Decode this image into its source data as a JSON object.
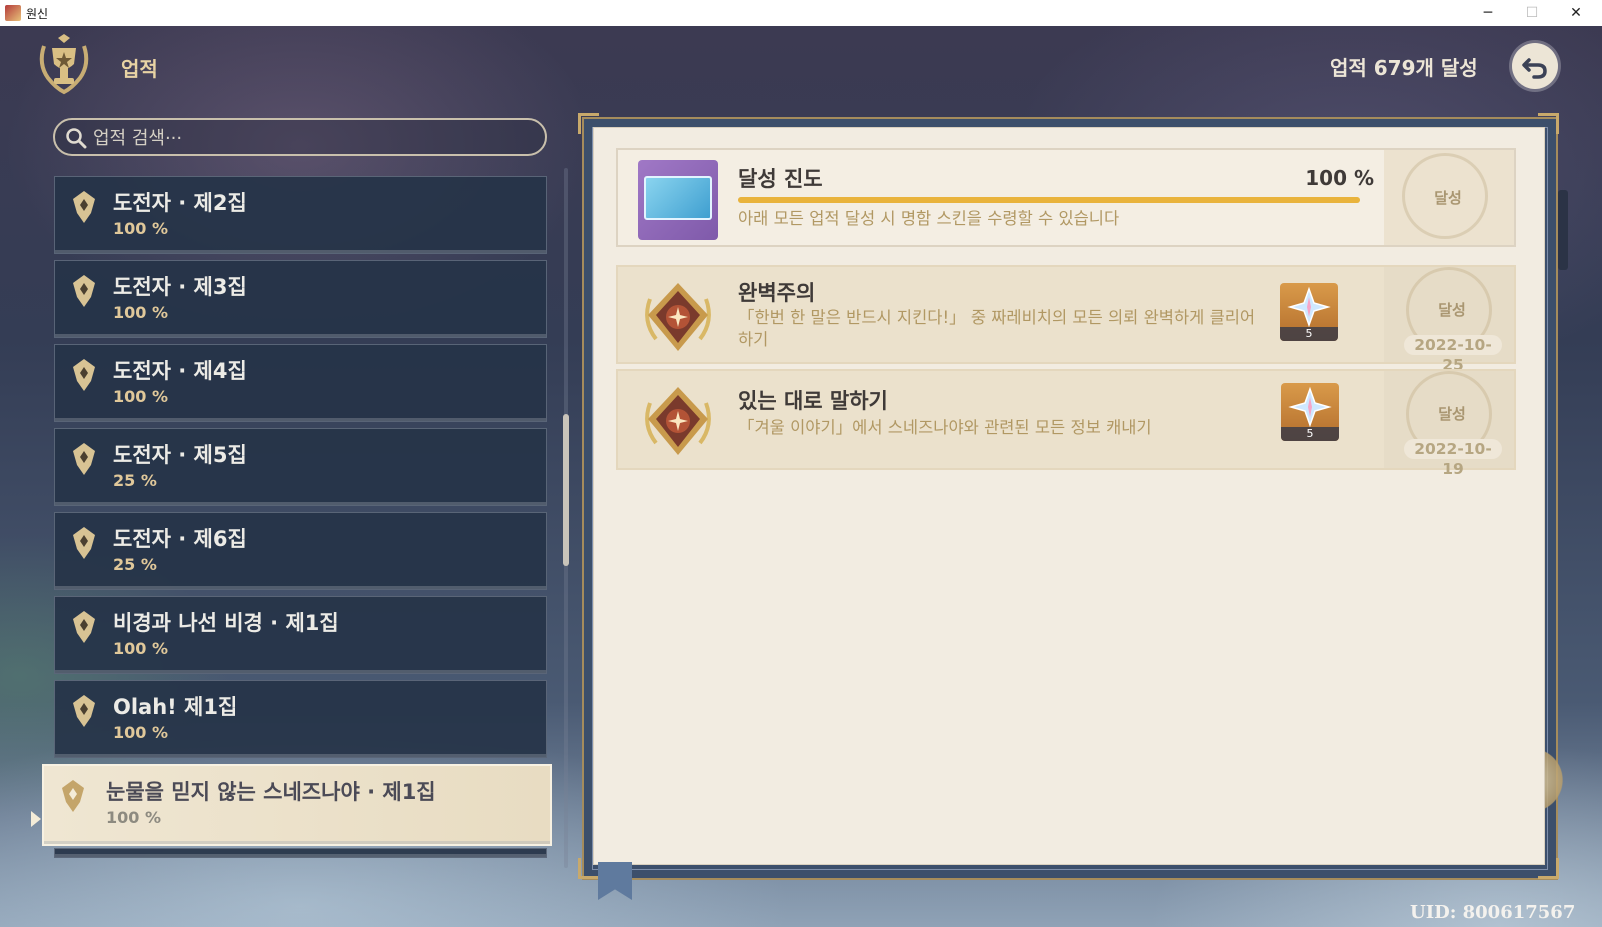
{
  "window": {
    "title": "원신",
    "min_glyph": "─",
    "max_glyph": "☐",
    "close_glyph": "✕"
  },
  "header": {
    "title": "업적",
    "achieved_count": "업적 679개 달성"
  },
  "search": {
    "placeholder": "업적 검색···"
  },
  "categories": [
    {
      "name": "도전자 · 제2집",
      "percent": "100 %"
    },
    {
      "name": "도전자 · 제3집",
      "percent": "100 %"
    },
    {
      "name": "도전자 · 제4집",
      "percent": "100 %"
    },
    {
      "name": "도전자 · 제5집",
      "percent": "25 %"
    },
    {
      "name": "도전자 · 제6집",
      "percent": "25 %"
    },
    {
      "name": "비경과 나선 비경 · 제1집",
      "percent": "100 %"
    },
    {
      "name": "Olah! 제1집",
      "percent": "100 %"
    },
    {
      "name": "눈물을 믿지 않는 스네즈나야 · 제1집",
      "percent": "100 %",
      "selected": true
    }
  ],
  "progress": {
    "title": "달성 진도",
    "percent": "100 %",
    "fraction": 1.0,
    "description": "아래 모든 업적 달성 시 명함 스킨을 수령할 수 있습니다",
    "stamp_label": "달성"
  },
  "achievements": [
    {
      "title": "완벽주의",
      "description": "「한번 한 말은 반드시 지킨다!」 중 짜레비치의 모든 의뢰 완벽하게 클리어하기",
      "reward_count": "5",
      "stamp_label": "달성",
      "date": "2022-10-25"
    },
    {
      "title": "있는 대로 말하기",
      "description": "「겨울 이야기」에서 스네즈나야와 관련된 모든 정보 캐내기",
      "reward_count": "5",
      "stamp_label": "달성",
      "date": "2022-10-19"
    }
  ],
  "footer": {
    "uid": "UID: 800617567"
  },
  "colors": {
    "accent_gold": "#e9b33c",
    "panel_bg": "#f2ece1",
    "list_bg": "#263448"
  }
}
